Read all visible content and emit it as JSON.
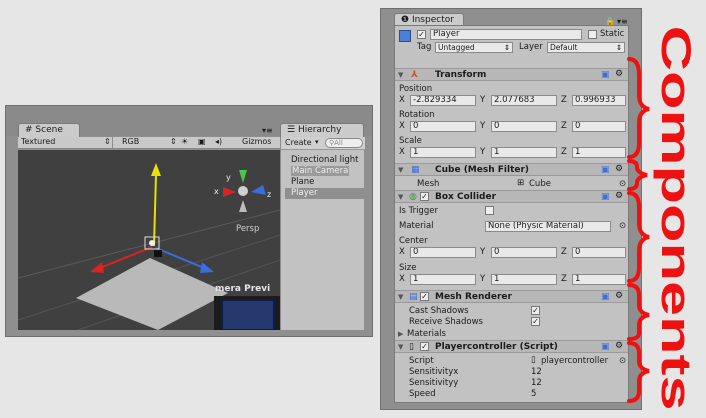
{
  "scene": {
    "tab_label": "Scene",
    "toolbar": {
      "shading": "Textured",
      "render_mode": "RGB",
      "gizmos": "Gizmos"
    },
    "persp_label": "Persp",
    "camera_preview_label": "mera Previ"
  },
  "hierarchy": {
    "tab_label": "Hierarchy",
    "create_label": "Create",
    "search_placeholder": "All",
    "items": [
      {
        "label": "Directional light",
        "selected": false
      },
      {
        "label": "Main Camera",
        "selected": false
      },
      {
        "label": "Plane",
        "selected": false
      },
      {
        "label": "Player",
        "selected": true
      }
    ]
  },
  "inspector": {
    "tab_label": "Inspector",
    "object_name": "Player",
    "static_label": "Static",
    "tag_label": "Tag",
    "tag_value": "Untagged",
    "layer_label": "Layer",
    "layer_value": "Default",
    "transform": {
      "title": "Transform",
      "position_label": "Position",
      "position": {
        "x": "-2.829334",
        "y": "2.077683",
        "z": "0.996933"
      },
      "rotation_label": "Rotation",
      "rotation": {
        "x": "0",
        "y": "0",
        "z": "0"
      },
      "scale_label": "Scale",
      "scale": {
        "x": "1",
        "y": "1",
        "z": "1"
      }
    },
    "mesh_filter": {
      "title": "Cube (Mesh Filter)",
      "mesh_label": "Mesh",
      "mesh_value": "Cube"
    },
    "box_collider": {
      "title": "Box Collider",
      "is_trigger_label": "Is Trigger",
      "material_label": "Material",
      "material_value": "None (Physic Material)",
      "center_label": "Center",
      "center": {
        "x": "0",
        "y": "0",
        "z": "0"
      },
      "size_label": "Size",
      "size": {
        "x": "1",
        "y": "1",
        "z": "1"
      }
    },
    "mesh_renderer": {
      "title": "Mesh Renderer",
      "cast_shadows_label": "Cast Shadows",
      "receive_shadows_label": "Receive Shadows",
      "materials_label": "Materials"
    },
    "script": {
      "title": "Playercontroller (Script)",
      "script_label": "Script",
      "script_value": "playercontroller",
      "sensx_label": "Sensitivityx",
      "sensx_value": "12",
      "sensy_label": "Sensitivityy",
      "sensy_value": "12",
      "speed_label": "Speed",
      "speed_value": "5"
    }
  },
  "annotation": {
    "components_text": "Components",
    "color": "#ee1111"
  },
  "axis_labels": {
    "x": "x",
    "y": "y",
    "z": "z"
  },
  "colors": {
    "selection": "#8f8f8f",
    "panel": "#c2c2c2",
    "header": "#b7b7b7"
  }
}
